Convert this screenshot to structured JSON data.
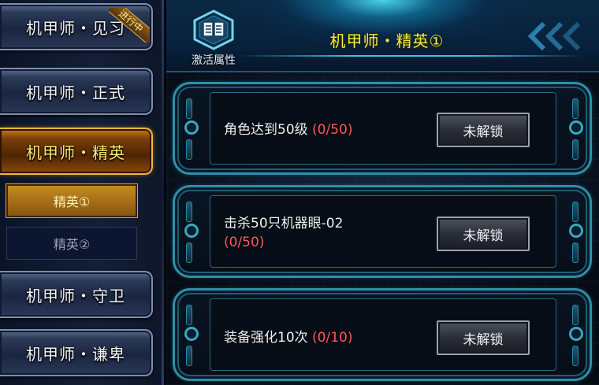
{
  "sidebar": {
    "ranks": [
      {
        "label": "机甲师・见习",
        "status_badge": "进行中"
      },
      {
        "label": "机甲师・正式"
      },
      {
        "label": "机甲师・精英"
      },
      {
        "label": "机甲师・守卫"
      },
      {
        "label": "机甲师・谦卑"
      }
    ],
    "selected_rank_index": 2,
    "sub_tabs": [
      {
        "label": "精英①",
        "selected": true
      },
      {
        "label": "精英②",
        "selected": false
      }
    ]
  },
  "header": {
    "title": "机甲师・精英①",
    "attributes_button_label": "激活属性",
    "attributes_icon": "book-icon"
  },
  "tasks": [
    {
      "text": "角色达到50级",
      "progress": "(0/50)",
      "button_label": "未解锁"
    },
    {
      "text": "击杀50只机器眼-02",
      "progress": "(0/50)",
      "button_label": "未解锁"
    },
    {
      "text": "装备强化10次",
      "progress": "(0/10)",
      "button_label": "未解锁"
    }
  ],
  "colors": {
    "title": "#f4ec3c",
    "progress": "#ff5a5a",
    "active_tab_text": "#ffe873",
    "card_border": "#2f8fa8"
  }
}
